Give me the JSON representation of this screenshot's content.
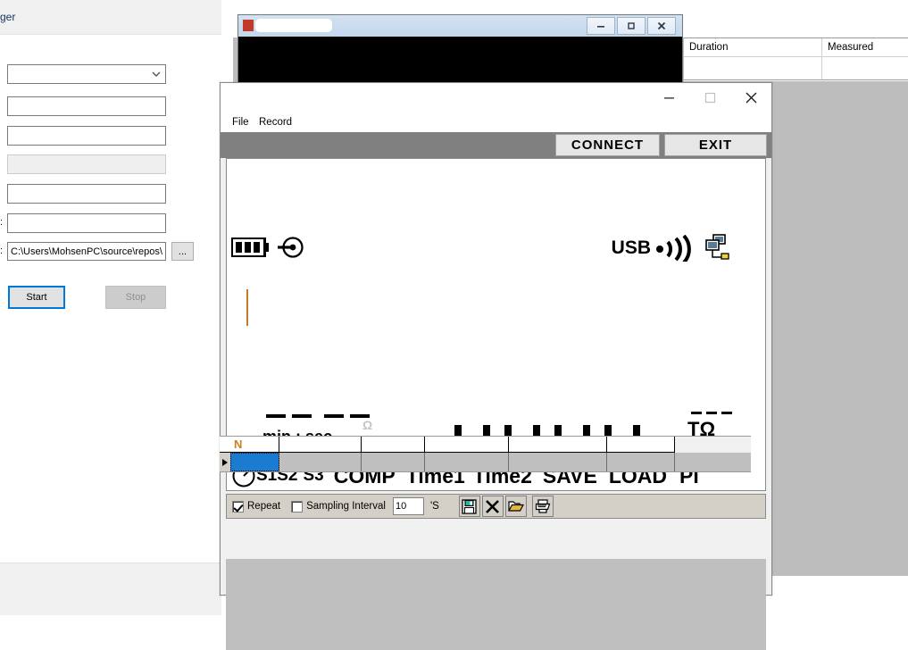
{
  "logger_window": {
    "title": "ger",
    "fields": [
      {
        "name": "port-select",
        "value": "",
        "type": "combobox"
      },
      {
        "name": "field-2",
        "value": "",
        "type": "text"
      },
      {
        "name": "field-3",
        "value": "",
        "type": "text"
      },
      {
        "name": "field-4",
        "value": "",
        "type": "text",
        "disabled": true
      },
      {
        "name": "field-5",
        "value": "",
        "type": "text"
      },
      {
        "name": "field-6",
        "value": "",
        "type": "text",
        "label": ":"
      },
      {
        "name": "path-field",
        "value": "C:\\Users\\MohsenPC\\source\\repos\\",
        "type": "text",
        "label": ":"
      }
    ],
    "browse_button": "...",
    "start_button": "Start",
    "stop_button": "Stop"
  },
  "background_table": {
    "columns": [
      "Duration",
      "Measured"
    ]
  },
  "console_window": {
    "title": "",
    "minimize": "–",
    "maximize": "□",
    "close": "✕"
  },
  "main_dialog": {
    "title": "",
    "menu": [
      "File",
      "Record"
    ],
    "connect_button": "CONNECT",
    "exit_button": "EXIT",
    "lcd": {
      "battery_icon": "battery-full-icon",
      "power_icon": "power-plug-icon",
      "usb_label": "USB",
      "wireless_icon": "wireless-waves-icon",
      "pc_icon": "pc-network-icon",
      "timer_label": "min : sec",
      "timer_value": "-- --",
      "ohm_small": "Ω",
      "main_value": "0.0.0.0",
      "unit_label": "TΩ",
      "unit_dashes": "---",
      "annunciators": [
        "S1",
        "S2",
        "S3",
        "COMP",
        "Time1",
        "Time2",
        "SAVE",
        "LOAD",
        "PI"
      ],
      "clock_icon": "clock-icon"
    },
    "toolbar": {
      "repeat_label": "Repeat",
      "repeat_checked": true,
      "sampling_label": "Sampling Interval",
      "sampling_checked": false,
      "interval_value": "10",
      "unit": "'S",
      "icons": [
        {
          "name": "save-icon",
          "title": "Save"
        },
        {
          "name": "delete-icon",
          "title": "Delete"
        },
        {
          "name": "open-folder-icon",
          "title": "Open"
        },
        {
          "name": "print-icon",
          "title": "Print"
        }
      ]
    },
    "grid": {
      "headers": [
        "N",
        "",
        "",
        "",
        "",
        ""
      ],
      "rows": [
        [
          "",
          "",
          "",
          "",
          "",
          ""
        ]
      ]
    }
  },
  "colors": {
    "accent": "#1a7bd1",
    "gray_band": "#808080",
    "grid_header_text": "#c8801e",
    "focus_blue": "#0078d7",
    "desktop_gray": "#bdbdbd"
  }
}
